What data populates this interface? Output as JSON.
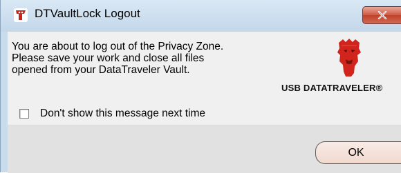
{
  "window": {
    "title": "DTVaultLock Logout",
    "close_glyph": "✕"
  },
  "message": {
    "lines": [
      "You are about to log out of the Privacy Zone.",
      "Please save your work and close all files",
      "opened from your DataTraveler Vault."
    ]
  },
  "branding": {
    "logo_text": "USB DATATRAVELER®",
    "icon": "kingston-head-icon",
    "color": "#d0241c"
  },
  "options": {
    "dont_show_label": "Don't show this message next time",
    "dont_show_checked": false
  },
  "buttons": {
    "ok_label": "OK"
  }
}
